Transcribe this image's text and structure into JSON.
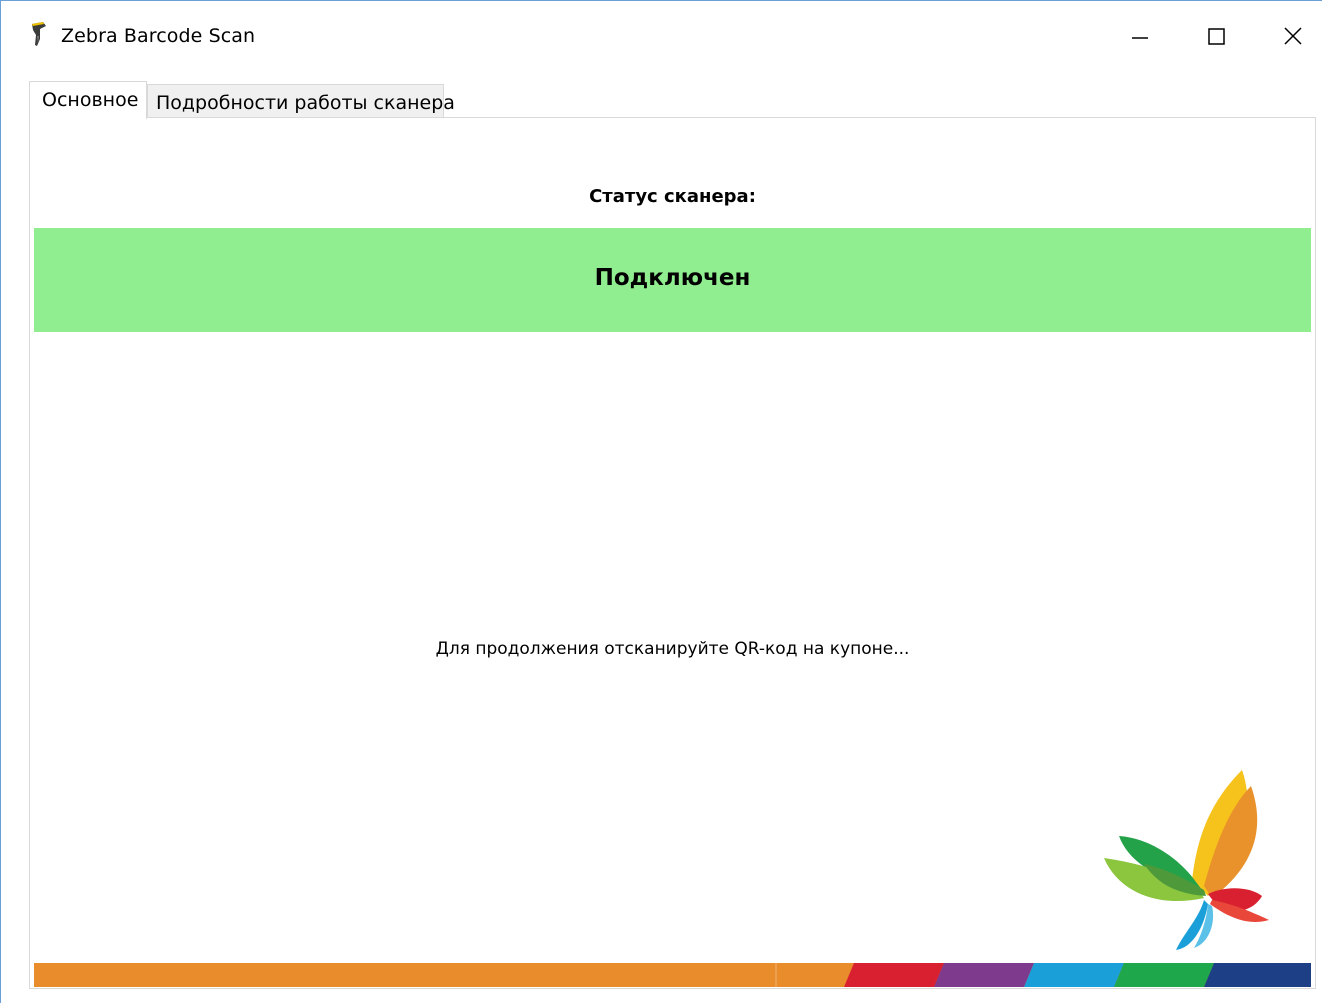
{
  "window": {
    "title": "Zebra Barcode Scan",
    "icons": {
      "app": "barcode-scanner-icon",
      "minimize": "minimize-icon",
      "maximize": "maximize-icon",
      "close": "close-icon"
    }
  },
  "tabs": [
    {
      "label": "Основное",
      "active": true
    },
    {
      "label": "Подробности работы сканера",
      "active": false
    }
  ],
  "main": {
    "status_label": "Статус сканера:",
    "status_value": "Подключен",
    "instruction": "Для продолжения отсканируйте QR-код на купоне...",
    "logo_icon": "butterfly-logo-icon"
  },
  "colors": {
    "status_bg": "#90ee90",
    "stripe": [
      "#e98c2b",
      "#d92030",
      "#7e3a8c",
      "#1a9fd9",
      "#1fa84b",
      "#1c3f86"
    ]
  }
}
